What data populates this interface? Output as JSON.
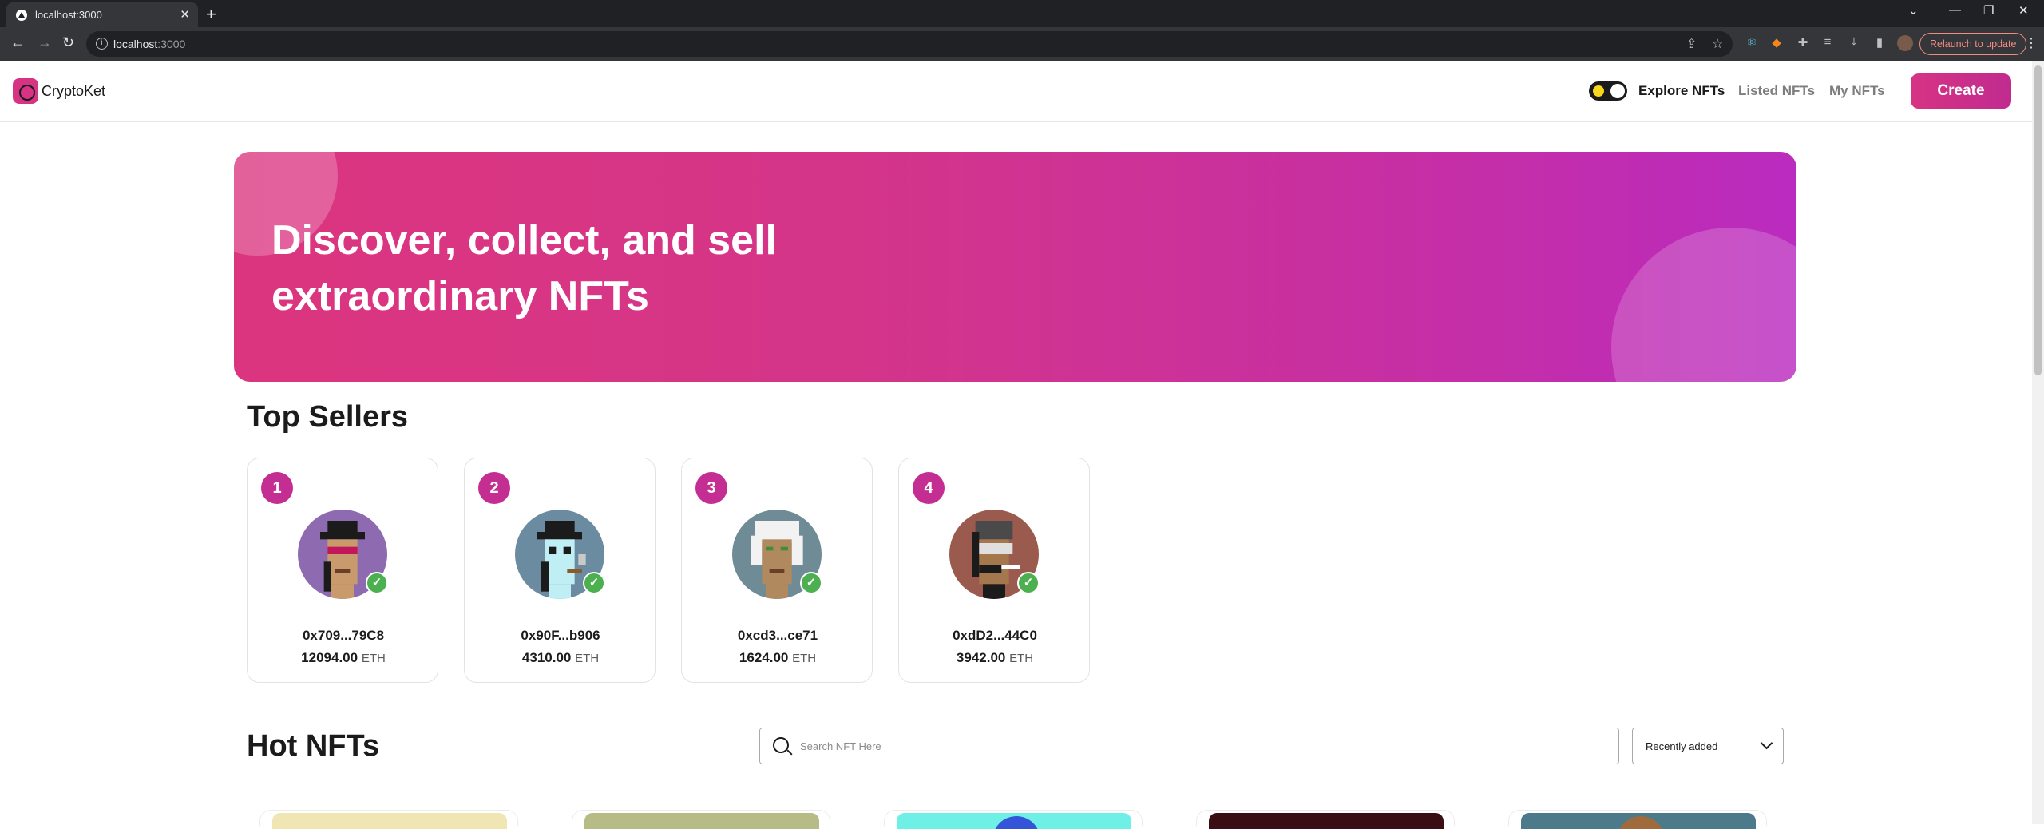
{
  "browser": {
    "tab_title": "localhost:3000",
    "url_host": "localhost",
    "url_port": ":3000",
    "relaunch_label": "Relaunch to update"
  },
  "nav": {
    "brand": "CryptoKet",
    "links": [
      "Explore NFTs",
      "Listed NFTs",
      "My NFTs"
    ],
    "active_link": "Explore NFTs",
    "create_label": "Create"
  },
  "banner": {
    "line1": "Discover, collect, and sell",
    "line2": "extraordinary NFTs"
  },
  "top_sellers": {
    "title": "Top Sellers",
    "sellers": [
      {
        "rank": "1",
        "address": "0x709...79C8",
        "amount": "12094.00",
        "unit": "ETH",
        "avatar_bg": "#8e6bb0"
      },
      {
        "rank": "2",
        "address": "0x90F...b906",
        "amount": "4310.00",
        "unit": "ETH",
        "avatar_bg": "#6a8ba0"
      },
      {
        "rank": "3",
        "address": "0xcd3...ce71",
        "amount": "1624.00",
        "unit": "ETH",
        "avatar_bg": "#6f8b96"
      },
      {
        "rank": "4",
        "address": "0xdD2...44C0",
        "amount": "3942.00",
        "unit": "ETH",
        "avatar_bg": "#9a5a4e"
      }
    ]
  },
  "hot_nfts": {
    "title": "Hot NFTs",
    "search_placeholder": "Search NFT Here",
    "sort_selected": "Recently added",
    "cards": [
      {
        "bg": "#f0e6b4"
      },
      {
        "bg": "#b7bb85"
      },
      {
        "bg": "#6ff0e6"
      },
      {
        "bg": "#3b0e14"
      },
      {
        "bg": "#4d7a8a"
      }
    ]
  },
  "colors": {
    "accent": "#d63384",
    "verified": "#4caf50"
  }
}
